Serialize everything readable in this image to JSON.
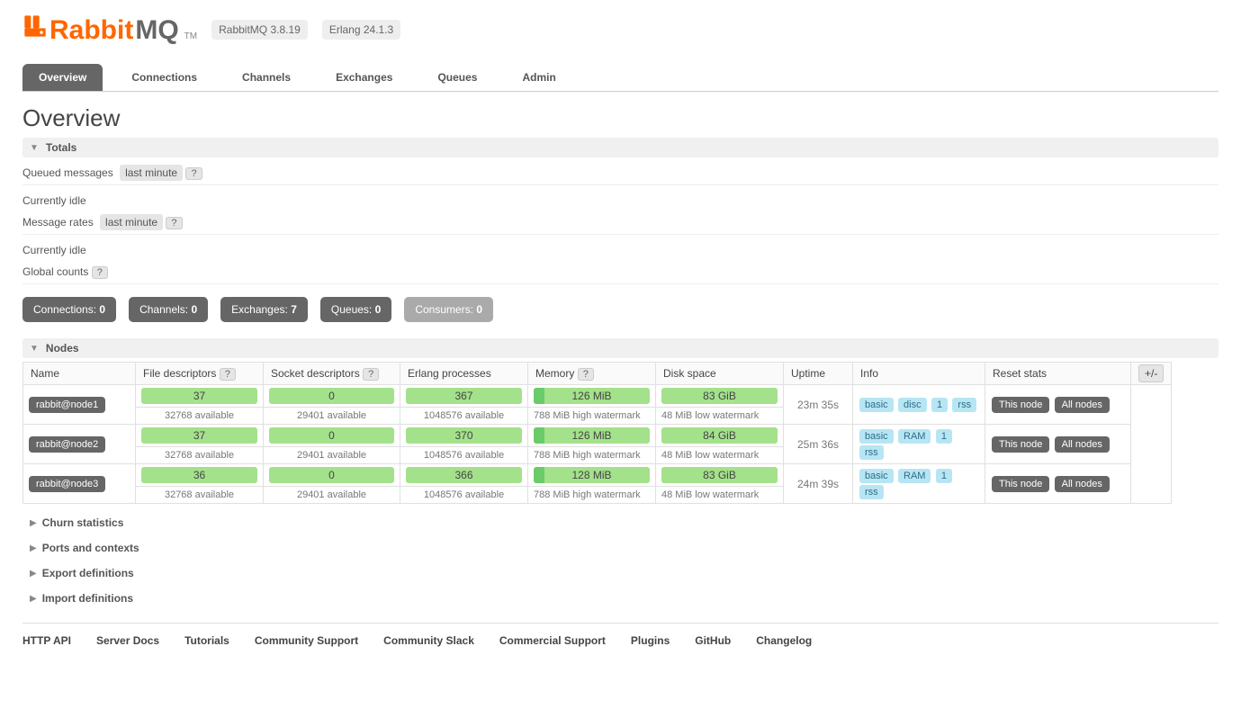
{
  "header": {
    "brand_prefix": "Rabbit",
    "brand_suffix": "MQ",
    "tm": "TM",
    "rabbitmq_version": "RabbitMQ 3.8.19",
    "erlang_version": "Erlang 24.1.3"
  },
  "tabs": [
    "Overview",
    "Connections",
    "Channels",
    "Exchanges",
    "Queues",
    "Admin"
  ],
  "page_title": "Overview",
  "sections": {
    "totals": "Totals",
    "nodes": "Nodes",
    "churn": "Churn statistics",
    "ports": "Ports and contexts",
    "export": "Export definitions",
    "import": "Import definitions"
  },
  "totals": {
    "queued_label": "Queued messages",
    "queued_range": "last minute",
    "idle_1": "Currently idle",
    "rates_label": "Message rates",
    "rates_range": "last minute",
    "idle_2": "Currently idle",
    "global_label": "Global counts"
  },
  "counts": {
    "connections": {
      "label": "Connections:",
      "value": "0"
    },
    "channels": {
      "label": "Channels:",
      "value": "0"
    },
    "exchanges": {
      "label": "Exchanges:",
      "value": "7"
    },
    "queues": {
      "label": "Queues:",
      "value": "0"
    },
    "consumers": {
      "label": "Consumers:",
      "value": "0"
    }
  },
  "nodes": {
    "headers": {
      "name": "Name",
      "fd": "File descriptors",
      "sd": "Socket descriptors",
      "ep": "Erlang processes",
      "mem": "Memory",
      "disk": "Disk space",
      "uptime": "Uptime",
      "info": "Info",
      "reset": "Reset stats",
      "pm": "+/-"
    },
    "fd_avail": "32768 available",
    "sd_avail": "29401 available",
    "ep_avail": "1048576 available",
    "mem_wm": "788 MiB high watermark",
    "disk_wm": "48 MiB low watermark",
    "reset_this": "This node",
    "reset_all": "All nodes",
    "rows": [
      {
        "name": "rabbit@node1",
        "fd": "37",
        "sd": "0",
        "ep": "367",
        "mem": "126 MiB",
        "disk": "83 GiB",
        "uptime": "23m 35s",
        "info": [
          "basic",
          "disc",
          "1",
          "rss"
        ]
      },
      {
        "name": "rabbit@node2",
        "fd": "37",
        "sd": "0",
        "ep": "370",
        "mem": "126 MiB",
        "disk": "84 GiB",
        "uptime": "25m 36s",
        "info": [
          "basic",
          "RAM",
          "1",
          "rss"
        ]
      },
      {
        "name": "rabbit@node3",
        "fd": "36",
        "sd": "0",
        "ep": "366",
        "mem": "128 MiB",
        "disk": "83 GiB",
        "uptime": "24m 39s",
        "info": [
          "basic",
          "RAM",
          "1",
          "rss"
        ]
      }
    ]
  },
  "footer": [
    "HTTP API",
    "Server Docs",
    "Tutorials",
    "Community Support",
    "Community Slack",
    "Commercial Support",
    "Plugins",
    "GitHub",
    "Changelog"
  ],
  "help_char": "?"
}
